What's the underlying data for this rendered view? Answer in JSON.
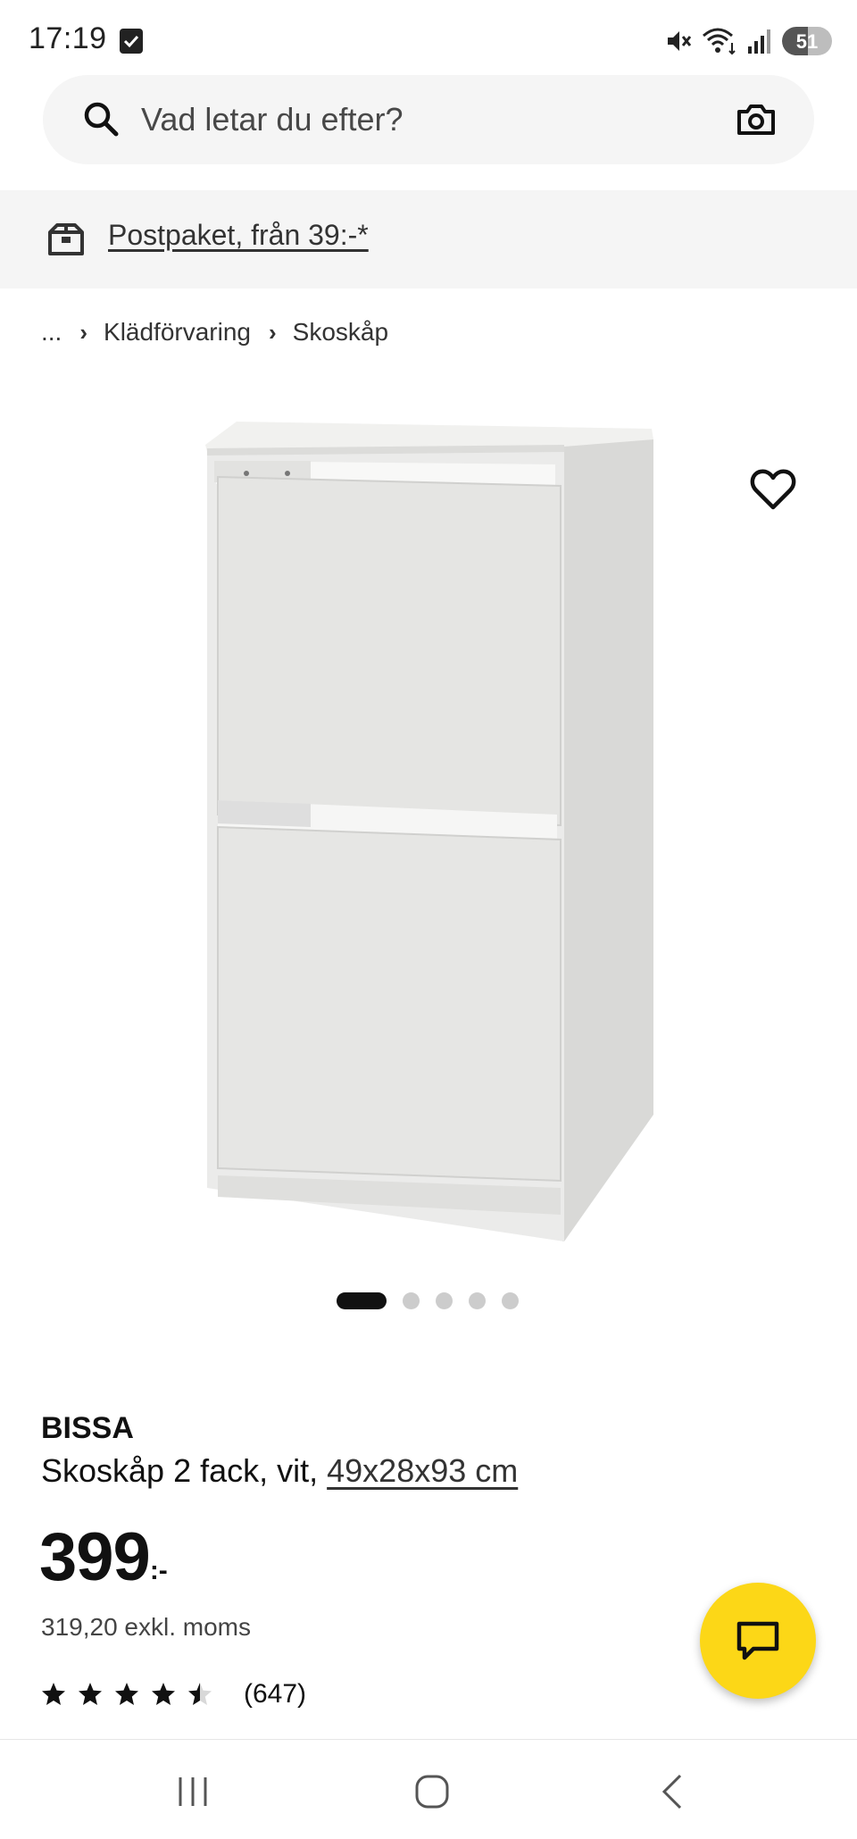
{
  "status_bar": {
    "time": "17:19",
    "battery": "51",
    "battery_level": 0.51
  },
  "search": {
    "placeholder": "Vad letar du efter?"
  },
  "delivery": {
    "label": "Postpaket, från 39:-*"
  },
  "breadcrumb": {
    "ellipsis": "...",
    "items": [
      "Klädförvaring",
      "Skoskåp"
    ]
  },
  "carousel": {
    "total": 5,
    "active": 1
  },
  "product": {
    "brand": "BISSA",
    "description": "Skoskåp 2 fack, vit, ",
    "dimensions": "49x28x93 cm",
    "price": "399",
    "price_suffix": ":-",
    "price_excl": "319,20 exkl. moms",
    "rating": 4.5,
    "rating_max": 5,
    "review_count": "(647)"
  },
  "colors": {
    "accent_yellow": "#fcd717",
    "text": "#111111",
    "banner_bg": "#f5f5f5"
  },
  "icons": {
    "search": "search-icon",
    "camera": "camera-icon",
    "delivery": "delivery-box-icon",
    "favorite": "heart-icon",
    "chat": "chat-icon"
  }
}
